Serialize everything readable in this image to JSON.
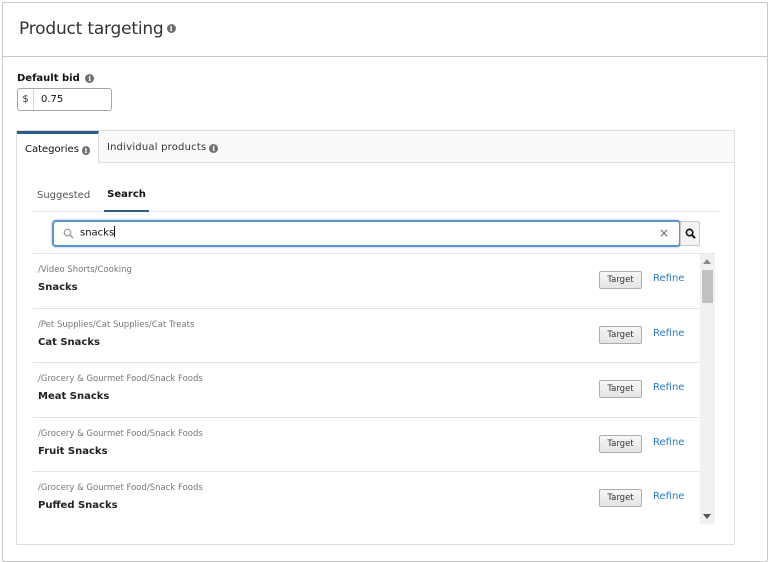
{
  "panel": {
    "title": "Product targeting"
  },
  "default_bid": {
    "label": "Default bid",
    "currency": "$",
    "value": "0.75"
  },
  "tabs": [
    {
      "label": "Categories",
      "active": true
    },
    {
      "label": "Individual products",
      "active": false
    }
  ],
  "subtabs": [
    {
      "label": "Suggested",
      "active": false
    },
    {
      "label": "Search",
      "active": true
    }
  ],
  "search": {
    "value": "snacks",
    "clear_glyph": "×"
  },
  "results": [
    {
      "path": "/Video Shorts/Cooking",
      "name": "Snacks",
      "target_label": "Target",
      "refine_label": "Refine"
    },
    {
      "path": "/Pet Supplies/Cat Supplies/Cat Treats",
      "name": "Cat Snacks",
      "target_label": "Target",
      "refine_label": "Refine"
    },
    {
      "path": "/Grocery & Gourmet Food/Snack Foods",
      "name": "Meat Snacks",
      "target_label": "Target",
      "refine_label": "Refine"
    },
    {
      "path": "/Grocery & Gourmet Food/Snack Foods",
      "name": "Fruit Snacks",
      "target_label": "Target",
      "refine_label": "Refine"
    },
    {
      "path": "/Grocery & Gourmet Food/Snack Foods",
      "name": "Puffed Snacks",
      "target_label": "Target",
      "refine_label": "Refine"
    }
  ],
  "colors": {
    "accent_tab": "#2e5a8a",
    "link": "#2a7ac0",
    "search_focus": "#5a93d0"
  }
}
